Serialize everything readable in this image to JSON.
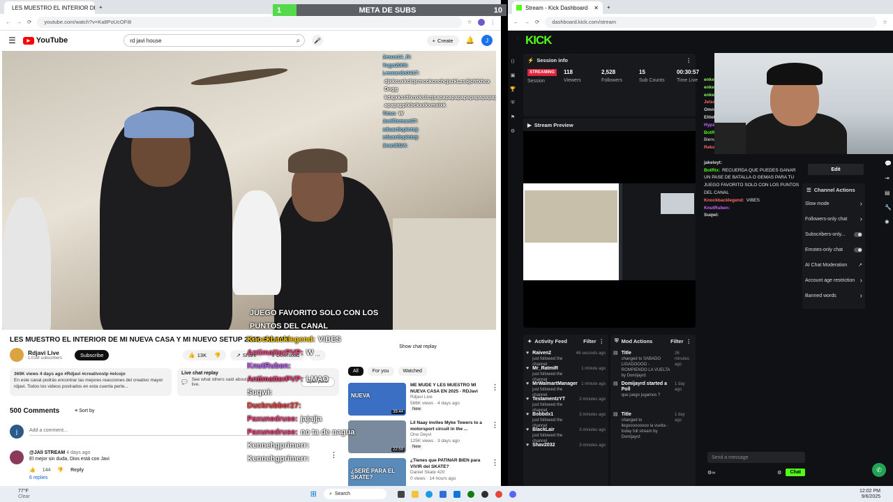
{
  "youtube_window": {
    "tab_title": "LES MUESTRO EL INTERIOR DE",
    "url": "youtube.com/watch?v=Ka8PoUcOFi8",
    "search_value": "rd javi house",
    "logo_text": "YouTube",
    "create_label": "Create",
    "account_initial": "J",
    "chat_overlay": [
      {
        "name": "Jesus14_R:",
        "msg": "",
        "color": "#8bd6ff"
      },
      {
        "name": "Yugo2005:",
        "msg": "",
        "color": "#8bd6ff"
      },
      {
        "name": "Leonardo0417:",
        "msg": "",
        "color": "#8bd6ff"
      },
      {
        "name": "",
        "msg": "djxkcuxkclcjcmcckcnchcjxzkLzsdjchfxhcx",
        "color": "#ffffff"
      },
      {
        "name": "",
        "msg": "Dogg",
        "color": "#ffffff"
      },
      {
        "name": "",
        "msg": "kdxjxks!dlxnxkslscjsapapapapapapapapapap",
        "color": "#ffffff"
      },
      {
        "name": "",
        "msg": "apapapplxbckxxkxmxixk",
        "color": "#ffffff"
      },
      {
        "name": "Timo:",
        "msg": "W",
        "color": "#8bd6ff"
      },
      {
        "name": "JoelRoman07:",
        "msg": "",
        "color": "#8bd6ff"
      },
      {
        "name": "eduardopintoj:",
        "msg": "",
        "color": "#8bd6ff"
      },
      {
        "name": "eduardopintoj:",
        "msg": "",
        "color": "#8bd6ff"
      },
      {
        "name": "Jean8024:",
        "msg": "",
        "color": "#8bd6ff"
      }
    ],
    "video_title": "LES MUESTRO EL INTERIOR DE MI NUEVA CASA Y MI NUEVO SETUP 2025 -RDJAVI",
    "channel_name": "Rdjavi Live",
    "subscribers": "1.01M subscribers",
    "subscribe_label": "Subscribe",
    "likes": "13K",
    "share_label": "Share",
    "download_label": "Download",
    "desc_meta": "369K views  4 days ago  #Rdjavi #creativostp #elcojo",
    "desc_text": "En este canal podrás encontrar las mejores reacciones del creativo mayor rdjavi. Todos los videos postrados en esta cuenta perte...",
    "desc_more": "...more",
    "live_chat_replay_title": "Live chat replay",
    "live_chat_replay_text": "See what others said about this video while it was live.",
    "open_panel_label": "Open panel",
    "show_chat_replay": "Show chat replay",
    "chips": [
      "All",
      "For you",
      "Watched"
    ],
    "comments_count": "500 Comments",
    "sort_by": "Sort by",
    "add_comment": "Add a comment...",
    "comment": {
      "author": "@JAlI STREAM",
      "time": "4 days ago",
      "text": "El mejor sin duda, Dios está con Javi",
      "likes": "144",
      "reply": "Reply",
      "replies": "6 replies"
    },
    "recommended": [
      {
        "title": "ME MUDE Y LES MUESTRO MI NUEVA CASA EN 2025 - RDJavi",
        "channel": "Rdjavi Live",
        "meta": "566K views · 4 days ago",
        "badge": "New",
        "duration": "39:44",
        "thumb_text": "NUEVA",
        "thumb_color": "#3a6fc4"
      },
      {
        "title": "Lil Naay invites Myke Towers to a motorsport circuit in the ...",
        "channel": "One Deyvi",
        "meta": "125K views · 3 days ago",
        "badge": "New",
        "duration": "22:59",
        "thumb_text": "",
        "thumb_color": "#7a8a9e"
      },
      {
        "title": "¿Tienes que PATINAR BIEN para VIVIR del SKATE?",
        "channel": "Daniel Skate 420",
        "meta": "0 views · 14 hours ago",
        "badge": "",
        "duration": "",
        "thumb_text": "¿SERÉ PARA EL SKATE?",
        "thumb_color": "#5a8ab8"
      }
    ]
  },
  "kick_window": {
    "tab_title": "Stream - Kick Dashboard",
    "url": "dashboard.kick.com/stream",
    "logo_text": "KICK",
    "session_info_title": "Session info",
    "streaming_badge": "STREAMING",
    "session_label": "Session",
    "stats": [
      {
        "value": "118",
        "label": "Viewers"
      },
      {
        "value": "2,528",
        "label": "Followers"
      },
      {
        "value": "15",
        "label": "Sub Counts"
      },
      {
        "value": "00:30:57",
        "label": "Time Live"
      }
    ],
    "stream_preview_title": "Stream Preview",
    "activity_feed_title": "Activity Feed",
    "filter_label": "Filter",
    "activity": [
      {
        "name": "Raiven2",
        "text": "just followed the channel",
        "time": "46 seconds ago"
      },
      {
        "name": "Mr_RatmiR",
        "text": "just followed the channel",
        "time": "1 minute ago"
      },
      {
        "name": "MrWalmartManager",
        "text": "just followed the channel",
        "time": "1 minute ago"
      },
      {
        "name": "TestamentzYT",
        "text": "just followed the channel",
        "time": "2 minutes ago"
      },
      {
        "name": "Bobbdx1",
        "text": "just followed the channel",
        "time": "3 minutes ago"
      },
      {
        "name": "BlackLair",
        "text": "just followed the channel",
        "time": "3 minutes ago"
      },
      {
        "name": "Shav2032",
        "text": "",
        "time": "3 minutes ago"
      }
    ],
    "mod_actions_title": "Mod Actions",
    "mod_actions": [
      {
        "name": "Title",
        "text": "changed to SABADO LIGADOOOO - ROMPIENDO LA VUELTA by Domijayrd",
        "time": "26 minutes ago"
      },
      {
        "name": "Domijayrd started a Poll",
        "text": "que juego jugamos ?",
        "time": "1 day ago"
      },
      {
        "name": "Title",
        "text": "changed to llegooooooooo la vuelta - today full stream by Domijayrd",
        "time": "1 day ago"
      }
    ],
    "chat_lines": [
      {
        "name": "enkeogetts:",
        "msg": "",
        "color": "#8cff5a"
      },
      {
        "name": "enkeogetts:",
        "msg": "",
        "color": "#8cff5a"
      },
      {
        "name": "enkeogetts:",
        "msg": "",
        "color": "#8cff5a"
      },
      {
        "name": "Jeisonplaitoh:",
        "msg": "weoooooooooo",
        "color": "#ff6b6b"
      },
      {
        "name": "OmniAlt:",
        "msg": "",
        "color": "#dddddd"
      },
      {
        "name": "EliteBasketball7:",
        "msg": "",
        "color": "#dddddd"
      },
      {
        "name": "Hypz6:",
        "msg": "",
        "color": "#cc66ff"
      },
      {
        "name": "BotRix:",
        "msg": "Gracias por seguirme @Raiven2 Bienvenido al mejor canal de kick",
        "color": "#53fc18"
      },
      {
        "name": "Rekon3208:",
        "msg": "",
        "color": "#ff6b6b"
      },
      {
        "name": "",
        "msg": "",
        "color": "#ff6b6b"
      },
      {
        "name": "jakeleyt:",
        "msg": "",
        "color": "#dddddd"
      },
      {
        "name": "BotRix:",
        "msg": "RECUERDA QUE PUEDES GANAR UN PASE DE BATALLA O GEMAS PARA TU JUEGO FAVORITO SOLO CON LOS PUNTOS DEL CANAL",
        "color": "#53fc18"
      },
      {
        "name": "Knockbacklegend:",
        "msg": "VIBES",
        "color": "#ff6b6b"
      },
      {
        "name": "KnutRuben:",
        "msg": "",
        "color": "#cc66ff"
      },
      {
        "name": "Suqwi:",
        "msg": "",
        "color": "#dddddd"
      }
    ],
    "send_message_placeholder": "Send a message",
    "chat_button": "Chat",
    "edit_label": "Edit",
    "channel_actions_title": "Channel Actions",
    "channel_actions": [
      {
        "label": "Slow mode",
        "kind": "arrow"
      },
      {
        "label": "Followers-only chat",
        "kind": "arrow"
      },
      {
        "label": "Subscribers-only...",
        "kind": "toggle"
      },
      {
        "label": "Emotes-only chat",
        "kind": "toggle"
      },
      {
        "label": "AI Chat Moderation",
        "kind": "link"
      },
      {
        "label": "Account age restriction",
        "kind": "arrow"
      },
      {
        "label": "Banned words",
        "kind": "arrow"
      }
    ]
  },
  "stream_overlay": {
    "meta_label": "META DE SUBS",
    "meta_current": "1",
    "meta_goal": "10",
    "meta_progress": 0.1,
    "big_chat": [
      {
        "name": "",
        "msg": "JUEGO FAVORITO SOLO CON LOS",
        "color": "#ffffff"
      },
      {
        "name": "",
        "msg": "PUNTOS DEL CANAL",
        "color": "#ffffff"
      },
      {
        "name": "Knockbacklegend:",
        "msg": "VIBES",
        "color": "#ffd000"
      },
      {
        "name": "AntimatterPVP:",
        "msg": "W",
        "color": "#ff3b7a"
      },
      {
        "name": "KnutRuben:",
        "msg": "",
        "color": "#c05bff"
      },
      {
        "name": "AntimatterPVP:",
        "msg": "LMAO",
        "color": "#ff3b7a"
      },
      {
        "name": "Suqwi:",
        "msg": "",
        "color": "#ffffff"
      },
      {
        "name": "Duckrubber27:",
        "msg": "",
        "color": "#ff3b3b"
      },
      {
        "name": "Paxunedruse:",
        "msg": "jajajja",
        "color": "#ff3b7a"
      },
      {
        "name": "Paxunedruse:",
        "msg": "no ta de nagua",
        "color": "#ff3b7a"
      },
      {
        "name": "Kennehgprimerr:",
        "msg": "",
        "color": "#ffffff"
      },
      {
        "name": "Kennehgprimerr:",
        "msg": "",
        "color": "#ffffff"
      }
    ]
  },
  "taskbar": {
    "weather_temp": "77°F",
    "weather_desc": "Clear",
    "search_placeholder": "Search",
    "time": "12:02 PM",
    "date": "9/6/2025"
  }
}
